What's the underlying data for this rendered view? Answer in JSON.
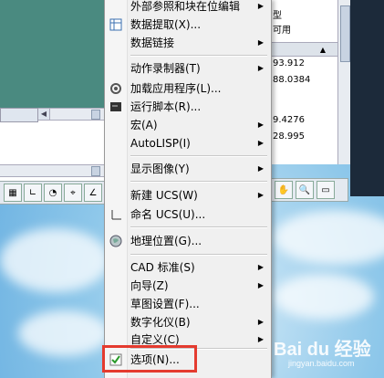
{
  "menu": {
    "items": [
      {
        "label": "外部参照和块在位编辑",
        "submenu": true,
        "icon": ""
      },
      {
        "label": "数据提取(X)...",
        "submenu": false,
        "icon": "data-extraction-icon"
      },
      {
        "label": "数据链接",
        "submenu": true,
        "icon": ""
      },
      {
        "label": "动作录制器(T)",
        "submenu": true,
        "icon": ""
      },
      {
        "label": "加载应用程序(L)...",
        "submenu": false,
        "icon": "load-application-icon"
      },
      {
        "label": "运行脚本(R)...",
        "submenu": false,
        "icon": "run-script-icon"
      },
      {
        "label": "宏(A)",
        "submenu": true,
        "icon": ""
      },
      {
        "label": "AutoLISP(I)",
        "submenu": true,
        "icon": ""
      },
      {
        "label": "显示图像(Y)",
        "submenu": true,
        "icon": ""
      },
      {
        "label": "新建 UCS(W)",
        "submenu": true,
        "icon": ""
      },
      {
        "label": "命名 UCS(U)...",
        "submenu": false,
        "icon": "named-ucs-icon"
      },
      {
        "label": "地理位置(G)...",
        "submenu": false,
        "icon": "geographic-location-icon"
      },
      {
        "label": "CAD 标准(S)",
        "submenu": true,
        "icon": ""
      },
      {
        "label": "向导(Z)",
        "submenu": true,
        "icon": ""
      },
      {
        "label": "草图设置(F)...",
        "submenu": false,
        "icon": ""
      },
      {
        "label": "数字化仪(B)",
        "submenu": true,
        "icon": ""
      },
      {
        "label": "自定义(C)",
        "submenu": true,
        "icon": ""
      },
      {
        "label": "选项(N)...",
        "submenu": false,
        "icon": "options-check-icon"
      }
    ]
  },
  "properties": {
    "row_type": "型",
    "row_available": "可用",
    "values": [
      "93.912",
      "88.0384",
      "9.4276",
      "28.995"
    ]
  },
  "watermark": {
    "text": "Bai du 经验",
    "sub": "jingyan.baidu.com"
  },
  "colors": {
    "highlight": "#e43b2f",
    "teal": "#4a8a80"
  }
}
